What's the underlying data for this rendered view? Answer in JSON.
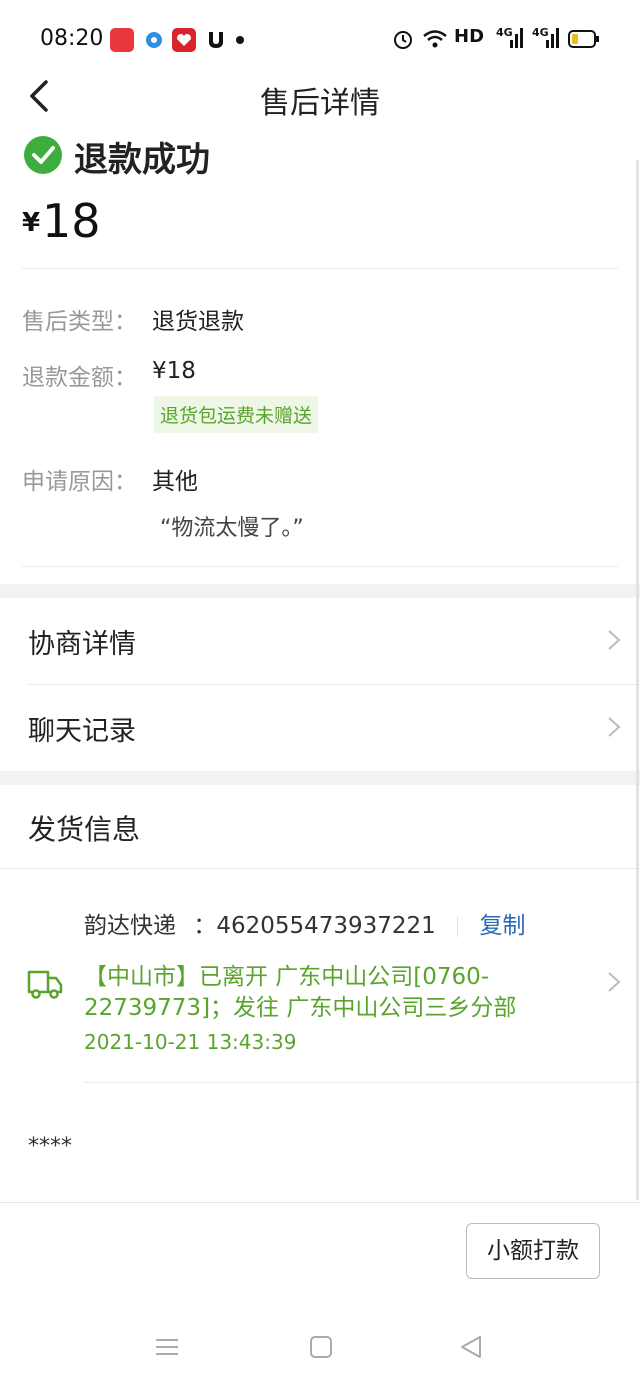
{
  "status_bar": {
    "time": "08:20",
    "network": "HD",
    "icons": [
      "app-red-icon",
      "app-blue-icon",
      "app-red2-icon",
      "app-mouse-icon",
      "dot-icon",
      "alarm-icon",
      "wifi-icon",
      "signal-4g-icon",
      "signal-4g-icon",
      "battery-icon"
    ],
    "signal_labels": [
      "4G",
      "4G"
    ]
  },
  "header": {
    "title": "售后详情",
    "back_icon": "chevron-left-icon"
  },
  "refund_status": {
    "title": "退款成功",
    "currency": "¥",
    "amount": "18",
    "accent_color": "#3dae3d"
  },
  "details": {
    "type_label": "售后类型：",
    "type_value": "退货退款",
    "amount_label": "退款金额：",
    "amount_value": "¥18",
    "badge": "退货包运费未赠送",
    "reason_label": "申请原因：",
    "reason_value": "其他",
    "reason_quote": "“物流太慢了。”"
  },
  "links": [
    {
      "label": "协商详情"
    },
    {
      "label": "聊天记录"
    }
  ],
  "shipping": {
    "title": "发货信息",
    "courier": "韵达快递",
    "tracking_prefix": "：",
    "tracking_no": "462055473937221",
    "copy_label": "复制",
    "track_text": "【中山市】已离开 广东中山公司[0760-22739773]；发往 广东中山公司三乡分部",
    "track_time": "2021-10-21 13:43:39",
    "masked": "****"
  },
  "bottom": {
    "button_label": "小额打款"
  },
  "system_nav": [
    "menu-icon",
    "home-square-icon",
    "back-triangle-icon"
  ]
}
